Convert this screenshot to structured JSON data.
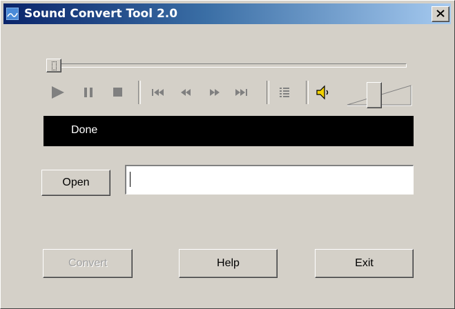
{
  "window": {
    "title": "Sound Convert Tool 2.0"
  },
  "player": {
    "seek_position": 0.0,
    "volume_level": 0.4,
    "status_text": "Done",
    "controls": [
      "play",
      "pause",
      "stop",
      "skip-back",
      "rewind",
      "fast-forward",
      "skip-forward",
      "playlist",
      "speaker"
    ]
  },
  "file": {
    "open_label": "Open",
    "path_value": ""
  },
  "actions": {
    "convert_label": "Convert",
    "help_label": "Help",
    "exit_label": "Exit"
  }
}
